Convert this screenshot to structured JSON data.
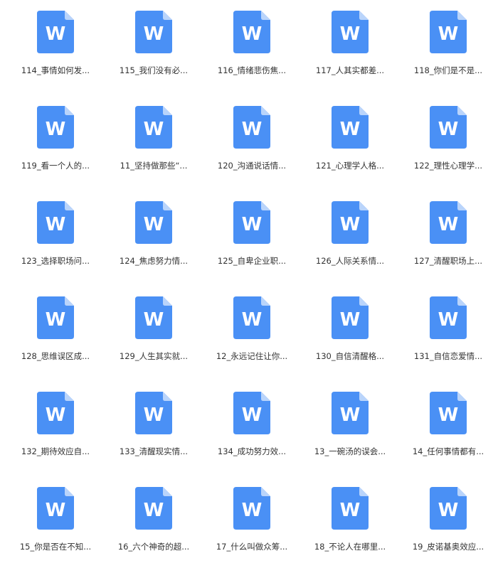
{
  "icon": {
    "name": "word-document-icon",
    "glyph": "W",
    "color_body": "#4a90f5",
    "color_fold": "#b9d4fb",
    "color_glyph": "#ffffff"
  },
  "files": [
    {
      "name": "114_事情如何发..."
    },
    {
      "name": "115_我们没有必..."
    },
    {
      "name": "116_情绪悲伤焦..."
    },
    {
      "name": "117_人其实都差..."
    },
    {
      "name": "118_你们是不是..."
    },
    {
      "name": "119_看一个人的..."
    },
    {
      "name": "11_坚持做那些“..."
    },
    {
      "name": "120_沟通说话情..."
    },
    {
      "name": "121_心理学人格..."
    },
    {
      "name": "122_理性心理学..."
    },
    {
      "name": "123_选择职场问..."
    },
    {
      "name": "124_焦虑努力情..."
    },
    {
      "name": "125_自卑企业职..."
    },
    {
      "name": "126_人际关系情..."
    },
    {
      "name": "127_清醒职场上..."
    },
    {
      "name": "128_思维误区成..."
    },
    {
      "name": "129_人生其实就..."
    },
    {
      "name": "12_永远记住让你..."
    },
    {
      "name": "130_自信清醒格..."
    },
    {
      "name": "131_自信恋爱情..."
    },
    {
      "name": "132_期待效应自..."
    },
    {
      "name": "133_清醒现实情..."
    },
    {
      "name": "134_成功努力效..."
    },
    {
      "name": "13_一碗汤的误会..."
    },
    {
      "name": "14_任何事情都有..."
    },
    {
      "name": "15_你是否在不知..."
    },
    {
      "name": "16_六个神奇的超..."
    },
    {
      "name": "17_什么叫做众筹..."
    },
    {
      "name": "18_不论人在哪里..."
    },
    {
      "name": "19_皮诺基奥效应..."
    }
  ]
}
